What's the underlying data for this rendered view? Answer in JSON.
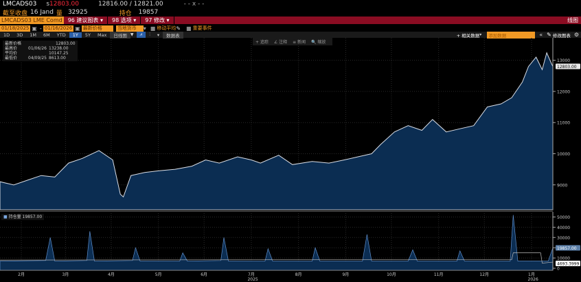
{
  "header": {
    "ticker": "LMCADS03",
    "last_prefix": "s",
    "last": "12803.00",
    "bid_ask": "12816.00 / 12821.00",
    "change": "- - x - -",
    "close_label": "截至收盘",
    "close_date": "16 Jand",
    "volume_label": "量",
    "volume": "32925",
    "oi_label": "持仓",
    "oi": "19857"
  },
  "menubar": {
    "security": "LMCADS03 LME Comd",
    "items": [
      {
        "num": "96",
        "label": "建议图表"
      },
      {
        "num": "98",
        "label": "选项"
      },
      {
        "num": "97",
        "label": "修改"
      }
    ],
    "right": "线图"
  },
  "controls": {
    "start_date": "01/18/2025",
    "end_date": "01/16/2026",
    "field": "最新价格",
    "currency": "当地货币",
    "moving_avg": "移动平均",
    "events": "重要事件"
  },
  "periods": [
    "1D",
    "3D",
    "1M",
    "6M",
    "YTD",
    "1Y",
    "5Y",
    "Max"
  ],
  "active_period": "1Y",
  "chart_type": "日线图",
  "table_btn": "数据表",
  "right_tools": {
    "related": "+ 相关数据",
    "add_placeholder": "添加数据",
    "edit": "修改图表"
  },
  "chart_tools": [
    "+ 追踪",
    "∠ 注释",
    "≡ 新闻",
    "🔍 缩放"
  ],
  "price_legend": [
    {
      "label": "最新价格",
      "date": "",
      "value": "12803.00"
    },
    {
      "label": "最高价",
      "date": "01/06/26",
      "value": "13238.00"
    },
    {
      "label": "平均价",
      "date": "",
      "value": "10147.25"
    },
    {
      "label": "最低价",
      "date": "04/09/25",
      "value": "8613.00"
    }
  ],
  "oi_legend": {
    "label": "持仓量",
    "value": "19857.00"
  },
  "colors": {
    "area": "#0b2d52",
    "line": "#d8dde6",
    "accent": "#f29a25",
    "bar": "#8a0c22"
  },
  "chart_data": [
    {
      "type": "area",
      "title": "最新价格",
      "x_unit": "day since 2025-01-18",
      "ylim": [
        8200,
        13720
      ],
      "yticks": [
        9000,
        10000,
        11000,
        12000,
        13000
      ],
      "last_label": "12803.00",
      "points": [
        [
          0,
          9100
        ],
        [
          9,
          9000
        ],
        [
          18,
          9150
        ],
        [
          27,
          9300
        ],
        [
          36,
          9250
        ],
        [
          45,
          9700
        ],
        [
          54,
          9850
        ],
        [
          65,
          10100
        ],
        [
          74,
          9800
        ],
        [
          79,
          8700
        ],
        [
          81,
          8613
        ],
        [
          86,
          9300
        ],
        [
          95,
          9400
        ],
        [
          104,
          9450
        ],
        [
          115,
          9500
        ],
        [
          126,
          9600
        ],
        [
          135,
          9800
        ],
        [
          144,
          9700
        ],
        [
          156,
          9900
        ],
        [
          165,
          9800
        ],
        [
          171,
          9700
        ],
        [
          183,
          9950
        ],
        [
          192,
          9650
        ],
        [
          205,
          9750
        ],
        [
          216,
          9700
        ],
        [
          226,
          9800
        ],
        [
          235,
          9900
        ],
        [
          244,
          10000
        ],
        [
          250,
          10300
        ],
        [
          259,
          10700
        ],
        [
          268,
          10900
        ],
        [
          277,
          10750
        ],
        [
          284,
          11100
        ],
        [
          293,
          10700
        ],
        [
          302,
          10800
        ],
        [
          311,
          10900
        ],
        [
          320,
          11500
        ],
        [
          329,
          11600
        ],
        [
          336,
          11800
        ],
        [
          343,
          12300
        ],
        [
          347,
          12800
        ],
        [
          352,
          13100
        ],
        [
          356,
          12700
        ],
        [
          359,
          13238
        ],
        [
          362,
          12900
        ],
        [
          363,
          12803
        ]
      ]
    },
    {
      "type": "area",
      "title": "持仓量",
      "ylim": [
        -2000,
        55000
      ],
      "yticks": [
        0,
        10000,
        20000,
        30000,
        40000,
        50000
      ],
      "last_label": "19857.00",
      "avg_label": "4693.3999",
      "points": [
        [
          0,
          7000
        ],
        [
          30,
          7500
        ],
        [
          33,
          30000
        ],
        [
          36,
          7000
        ],
        [
          57,
          7500
        ],
        [
          59,
          36000
        ],
        [
          62,
          7000
        ],
        [
          87,
          7500
        ],
        [
          89,
          20000
        ],
        [
          92,
          7000
        ],
        [
          118,
          7000
        ],
        [
          120,
          15000
        ],
        [
          123,
          7000
        ],
        [
          145,
          7500
        ],
        [
          147,
          30000
        ],
        [
          150,
          7000
        ],
        [
          174,
          7000
        ],
        [
          176,
          19000
        ],
        [
          179,
          7000
        ],
        [
          205,
          7000
        ],
        [
          207,
          20000
        ],
        [
          210,
          7000
        ],
        [
          238,
          7000
        ],
        [
          241,
          33000
        ],
        [
          244,
          7000
        ],
        [
          268,
          7000
        ],
        [
          271,
          18000
        ],
        [
          274,
          7000
        ],
        [
          300,
          7000
        ],
        [
          302,
          17000
        ],
        [
          305,
          7000
        ],
        [
          335,
          7000
        ],
        [
          337,
          52000
        ],
        [
          340,
          7000
        ],
        [
          360,
          7000
        ],
        [
          363,
          19857
        ]
      ]
    },
    {
      "type": "axis",
      "x_labels": [
        "2月",
        "3月",
        "4月",
        "5月",
        "6月",
        "7月",
        "8月",
        "9月",
        "10月",
        "11月",
        "12月",
        "1月"
      ],
      "x_days": [
        14,
        43,
        73,
        104,
        134,
        165,
        196,
        227,
        257,
        288,
        318,
        349
      ],
      "years": [
        {
          "label": "2025",
          "day": 166
        },
        {
          "label": "2026",
          "day": 350
        }
      ]
    }
  ]
}
